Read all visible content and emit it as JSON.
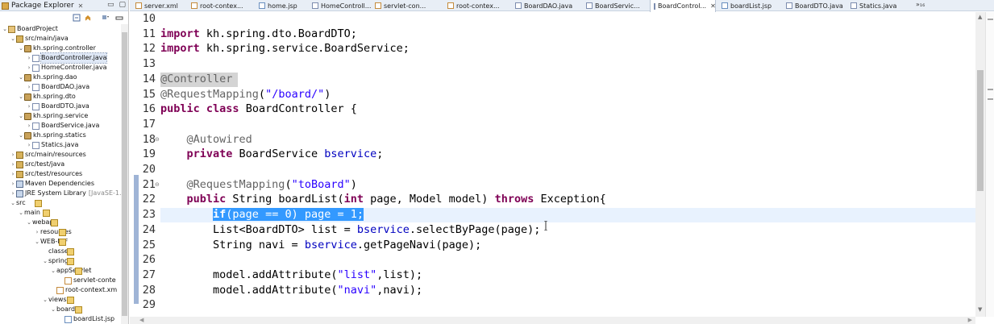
{
  "package_explorer": {
    "title": "Package Explorer",
    "tree": [
      {
        "label": "BoardProject",
        "icon": "project-icon",
        "level": 0,
        "expanded": true
      },
      {
        "label": "src/main/java",
        "icon": "source-folder-icon",
        "level": 1,
        "expanded": true
      },
      {
        "label": "kh.spring.controller",
        "icon": "package-icon",
        "level": 2,
        "expanded": true
      },
      {
        "label": "BoardController.java",
        "icon": "java-file-icon",
        "level": 3,
        "expanded": false,
        "selected": true
      },
      {
        "label": "HomeController.java",
        "icon": "java-file-icon",
        "level": 3,
        "expanded": false
      },
      {
        "label": "kh.spring.dao",
        "icon": "package-icon",
        "level": 2,
        "expanded": true
      },
      {
        "label": "BoardDAO.java",
        "icon": "java-file-icon",
        "level": 3,
        "expanded": false
      },
      {
        "label": "kh.spring.dto",
        "icon": "package-icon",
        "level": 2,
        "expanded": true
      },
      {
        "label": "BoardDTO.java",
        "icon": "java-file-icon",
        "level": 3,
        "expanded": false
      },
      {
        "label": "kh.spring.service",
        "icon": "package-icon",
        "level": 2,
        "expanded": true
      },
      {
        "label": "BoardService.java",
        "icon": "java-file-icon",
        "level": 3,
        "expanded": false
      },
      {
        "label": "kh.spring.statics",
        "icon": "package-icon",
        "level": 2,
        "expanded": true
      },
      {
        "label": "Statics.java",
        "icon": "java-file-icon",
        "level": 3,
        "expanded": false
      },
      {
        "label": "src/main/resources",
        "icon": "source-folder-icon",
        "level": 1,
        "expanded": false
      },
      {
        "label": "src/test/java",
        "icon": "source-folder-icon",
        "level": 1,
        "expanded": false
      },
      {
        "label": "src/test/resources",
        "icon": "source-folder-icon",
        "level": 1,
        "expanded": false
      },
      {
        "label": "Maven Dependencies",
        "icon": "library-icon",
        "level": 1,
        "expanded": false
      },
      {
        "label": "JRE System Library",
        "icon": "library-icon",
        "level": 1,
        "expanded": false,
        "suffix": "[JavaSE-1.8"
      },
      {
        "label": "src",
        "icon": "folder-icon",
        "level": 1,
        "expanded": true
      },
      {
        "label": "main",
        "icon": "folder-icon",
        "level": 2,
        "expanded": true
      },
      {
        "label": "webapp",
        "icon": "folder-icon",
        "level": 3,
        "expanded": true
      },
      {
        "label": "resources",
        "icon": "folder-icon",
        "level": 4,
        "expanded": false
      },
      {
        "label": "WEB-INF",
        "icon": "folder-icon",
        "level": 4,
        "expanded": true
      },
      {
        "label": "classes",
        "icon": "folder-icon",
        "level": 5,
        "expanded": null
      },
      {
        "label": "spring",
        "icon": "folder-icon",
        "level": 5,
        "expanded": true
      },
      {
        "label": "appServlet",
        "icon": "folder-icon",
        "level": 6,
        "expanded": true
      },
      {
        "label": "servlet-conte",
        "icon": "xml-file-icon",
        "level": 7,
        "expanded": null
      },
      {
        "label": "root-context.xm",
        "icon": "xml-file-icon",
        "level": 6,
        "expanded": null
      },
      {
        "label": "views",
        "icon": "folder-icon",
        "level": 5,
        "expanded": true
      },
      {
        "label": "board",
        "icon": "folder-icon",
        "level": 6,
        "expanded": true
      },
      {
        "label": "boardList.jsp",
        "icon": "jsp-file-icon",
        "level": 7,
        "expanded": null
      }
    ]
  },
  "editor_tabs": [
    {
      "label": "server.xml",
      "icon": "xml-file-icon",
      "active": false
    },
    {
      "label": "root-contex...",
      "icon": "xml-file-icon",
      "active": false
    },
    {
      "label": "home.jsp",
      "icon": "jsp-file-icon",
      "active": false
    },
    {
      "label": "HomeControll...",
      "icon": "java-file-icon",
      "active": false
    },
    {
      "label": "servlet-con...",
      "icon": "xml-file-icon",
      "active": false
    },
    {
      "label": "root-contex...",
      "icon": "xml-file-icon",
      "active": false
    },
    {
      "label": "BoardDAO.java",
      "icon": "java-file-icon",
      "active": false
    },
    {
      "label": "BoardServic...",
      "icon": "java-file-icon",
      "active": false
    },
    {
      "label": "BoardControl...",
      "icon": "java-file-icon",
      "active": true
    },
    {
      "label": "boardList.jsp",
      "icon": "jsp-file-icon",
      "active": false
    },
    {
      "label": "BoardDTO.java",
      "icon": "java-file-icon",
      "active": false
    },
    {
      "label": "Statics.java",
      "icon": "java-file-icon",
      "active": false
    }
  ],
  "tab_overflow": "»₁₆",
  "code_lines": [
    {
      "num": "10",
      "fold": "",
      "tokens": []
    },
    {
      "num": "11",
      "fold": "",
      "tokens": [
        {
          "t": "kw",
          "v": "import"
        },
        {
          "t": "",
          "v": " kh.spring.dto.BoardDTO;"
        }
      ]
    },
    {
      "num": "12",
      "fold": "",
      "tokens": [
        {
          "t": "kw",
          "v": "import"
        },
        {
          "t": "",
          "v": " kh.spring.service.BoardService;"
        }
      ]
    },
    {
      "num": "13",
      "fold": "",
      "tokens": []
    },
    {
      "num": "14",
      "fold": "",
      "tokens": [
        {
          "t": "an",
          "v": "@Controller"
        }
      ]
    },
    {
      "num": "15",
      "fold": "",
      "tokens": [
        {
          "t": "an",
          "v": "@RequestMapping"
        },
        {
          "t": "",
          "v": "("
        },
        {
          "t": "st",
          "v": "\"/board/\""
        },
        {
          "t": "",
          "v": ")"
        }
      ]
    },
    {
      "num": "16",
      "fold": "",
      "tokens": [
        {
          "t": "kw",
          "v": "public"
        },
        {
          "t": "",
          "v": " "
        },
        {
          "t": "kw",
          "v": "class"
        },
        {
          "t": "",
          "v": " BoardController {"
        }
      ]
    },
    {
      "num": "17",
      "fold": "",
      "tokens": []
    },
    {
      "num": "18",
      "fold": "⊖",
      "tokens": [
        {
          "t": "",
          "v": "    "
        },
        {
          "t": "an",
          "v": "@Autowired"
        }
      ]
    },
    {
      "num": "19",
      "fold": "",
      "tokens": [
        {
          "t": "",
          "v": "    "
        },
        {
          "t": "kw",
          "v": "private"
        },
        {
          "t": "",
          "v": " BoardService "
        },
        {
          "t": "fd",
          "v": "bservice"
        },
        {
          "t": "",
          "v": ";"
        }
      ]
    },
    {
      "num": "20",
      "fold": "",
      "tokens": []
    },
    {
      "num": "21",
      "fold": "⊖",
      "tokens": [
        {
          "t": "",
          "v": "    "
        },
        {
          "t": "an",
          "v": "@RequestMapping"
        },
        {
          "t": "",
          "v": "("
        },
        {
          "t": "st",
          "v": "\"toBoard\""
        },
        {
          "t": "",
          "v": ")"
        }
      ]
    },
    {
      "num": "22",
      "fold": "",
      "tokens": [
        {
          "t": "",
          "v": "    "
        },
        {
          "t": "kw",
          "v": "public"
        },
        {
          "t": "",
          "v": " String boardList("
        },
        {
          "t": "kw",
          "v": "int"
        },
        {
          "t": "",
          "v": " page, Model model) "
        },
        {
          "t": "kw",
          "v": "throws"
        },
        {
          "t": "",
          "v": " Exception{"
        }
      ]
    },
    {
      "num": "23",
      "fold": "",
      "tokens": [
        {
          "t": "",
          "v": "        "
        },
        {
          "t": "sel-kw",
          "v": "if"
        },
        {
          "t": "sel",
          "v": "(page == 0) page = 1;"
        }
      ]
    },
    {
      "num": "24",
      "fold": "",
      "tokens": [
        {
          "t": "",
          "v": "        List<BoardDTO> list = "
        },
        {
          "t": "fd",
          "v": "bservice"
        },
        {
          "t": "",
          "v": ".selectByPage(page);"
        }
      ]
    },
    {
      "num": "25",
      "fold": "",
      "tokens": [
        {
          "t": "",
          "v": "        String navi = "
        },
        {
          "t": "fd",
          "v": "bservice"
        },
        {
          "t": "",
          "v": ".getPageNavi(page);"
        }
      ]
    },
    {
      "num": "26",
      "fold": "",
      "tokens": []
    },
    {
      "num": "27",
      "fold": "",
      "tokens": [
        {
          "t": "",
          "v": "        model.addAttribute("
        },
        {
          "t": "st",
          "v": "\"list\""
        },
        {
          "t": "",
          "v": ",list);"
        }
      ]
    },
    {
      "num": "28",
      "fold": "",
      "tokens": [
        {
          "t": "",
          "v": "        model.addAttribute("
        },
        {
          "t": "st",
          "v": "\"navi\""
        },
        {
          "t": "",
          "v": ",navi);"
        }
      ]
    },
    {
      "num": "29",
      "fold": "",
      "tokens": []
    }
  ],
  "colors": {
    "keyword": "#7f0055",
    "annotation": "#646464",
    "string": "#2a00ff",
    "field": "#0000c0",
    "selection": "#3399ff",
    "current_line": "#e8f2fe"
  }
}
